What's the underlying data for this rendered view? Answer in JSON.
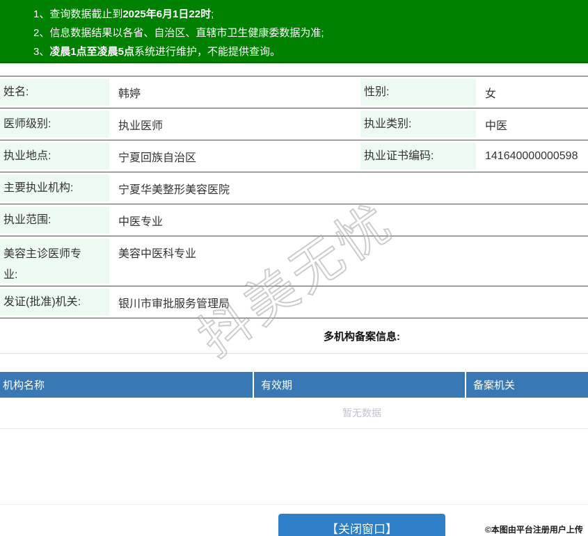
{
  "notice": {
    "lines": [
      {
        "pre": "1、查询数据截止到",
        "bold": "2025年6月1日22时",
        "post": ";"
      },
      {
        "pre": "2、信息数据结果以各省、自治区、直辖市卫生健康委数据为准;",
        "bold": "",
        "post": ""
      },
      {
        "pre": "3、",
        "bold": "凌晨1点至凌晨5点",
        "post": "系统进行维护，不能提供查询。"
      }
    ]
  },
  "profile": {
    "rows": [
      {
        "label": "姓名:",
        "value": "韩婷",
        "label2": "性别:",
        "value2": "女"
      },
      {
        "label": "医师级别:",
        "value": "执业医师",
        "label2": "执业类别:",
        "value2": "中医"
      },
      {
        "label": "执业地点:",
        "value": "宁夏回族自治区",
        "label2": "执业证书编码:",
        "value2": "141640000000598"
      },
      {
        "label": "主要执业机构:",
        "value": "宁夏华美整形美容医院"
      },
      {
        "label": "执业范围:",
        "value": "中医专业"
      },
      {
        "label": "美容主诊医师专业:",
        "value": "美容中医科专业"
      },
      {
        "label": "发证(批准)机关:",
        "value": "银川市审批服务管理局"
      }
    ]
  },
  "filing": {
    "title": "多机构备案信息:",
    "columns": [
      "机构名称",
      "有效期",
      "备案机关"
    ],
    "empty_text": "暂无数据"
  },
  "watermark_text": "抖美无忧",
  "footer": {
    "close_button": "【关闭窗口】",
    "copyright": "©本图由平台注册用户上传"
  },
  "colors": {
    "banner_green": "#008000",
    "row_border_green": "#156f4a",
    "label_bg_mint": "#edfaf2",
    "table_header_blue": "#3878b4",
    "button_blue": "#2e81c9",
    "empty_text_gray": "#c0c4cc"
  }
}
